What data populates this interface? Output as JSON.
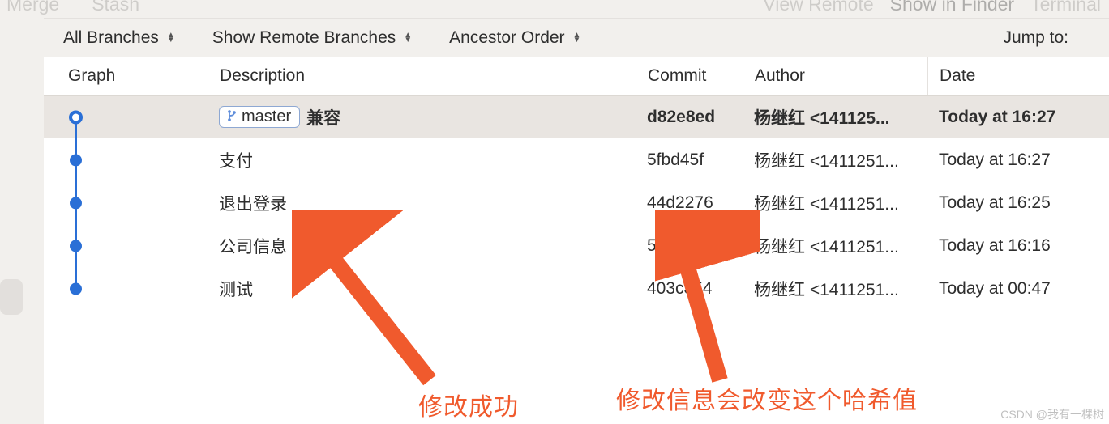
{
  "toolbar_ghost": {
    "merge": "Merge",
    "stash": "Stash",
    "view_remote": "View Remote",
    "show_in_finder": "Show in Finder",
    "terminal": "Terminal"
  },
  "filters": {
    "branches": "All Branches",
    "remote": "Show Remote Branches",
    "order": "Ancestor Order",
    "jump": "Jump to:"
  },
  "headers": {
    "graph": "Graph",
    "desc": "Description",
    "commit": "Commit",
    "author": "Author",
    "date": "Date"
  },
  "branch_tag": "master",
  "commits": [
    {
      "desc": "兼容",
      "commit": "d82e8ed",
      "author": "杨继红 <141125...",
      "date": "Today at 16:27",
      "head": true
    },
    {
      "desc": "支付",
      "commit": "5fbd45f",
      "author": "杨继红 <1411251...",
      "date": "Today at 16:27",
      "head": false
    },
    {
      "desc": "退出登录",
      "commit": "44d2276",
      "author": "杨继红 <1411251...",
      "date": "Today at 16:25",
      "head": false
    },
    {
      "desc": "公司信息",
      "commit": "577   c81",
      "author": "杨继红 <1411251...",
      "date": "Today at 16:16",
      "head": false
    },
    {
      "desc": "测试",
      "commit": "403c354",
      "author": "杨继红 <1411251...",
      "date": "Today at 00:47",
      "head": false
    }
  ],
  "annotations": {
    "left": "修改成功",
    "right": "修改信息会改变这个哈希值"
  },
  "watermark": "CSDN @我有一棵树"
}
